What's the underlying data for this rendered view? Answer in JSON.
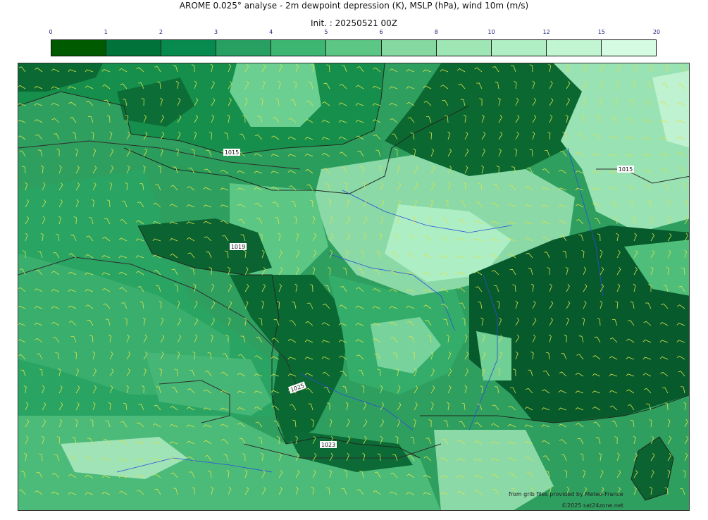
{
  "header": {
    "title": "AROME 0.025° analyse - 2m dewpoint depression (K), MSLP (hPa), wind 10m (m/s)",
    "init": "Init. : 20250521 00Z"
  },
  "colorbar": {
    "ticks": [
      "0",
      "1",
      "2",
      "3",
      "4",
      "5",
      "6",
      "8",
      "10",
      "12",
      "15",
      "20"
    ],
    "colors": [
      "#005a00",
      "#00733a",
      "#078a4e",
      "#27a061",
      "#3db672",
      "#5cc685",
      "#85d8a0",
      "#9ee6b4",
      "#b0efc3",
      "#c2f5d2",
      "#d6fbe3"
    ]
  },
  "map": {
    "isobar_labels": [
      "1015",
      "1019",
      "1025",
      "1023",
      "1015"
    ],
    "line_colors": {
      "coast": "#1e2a1e",
      "river": "#2a4fd8",
      "isobar": "#2e2e2e",
      "barb": "#d9e34a"
    }
  },
  "credits": {
    "source": "from grib files provided by Meteo-France",
    "copyright": "©2025 sat24zone.net"
  }
}
